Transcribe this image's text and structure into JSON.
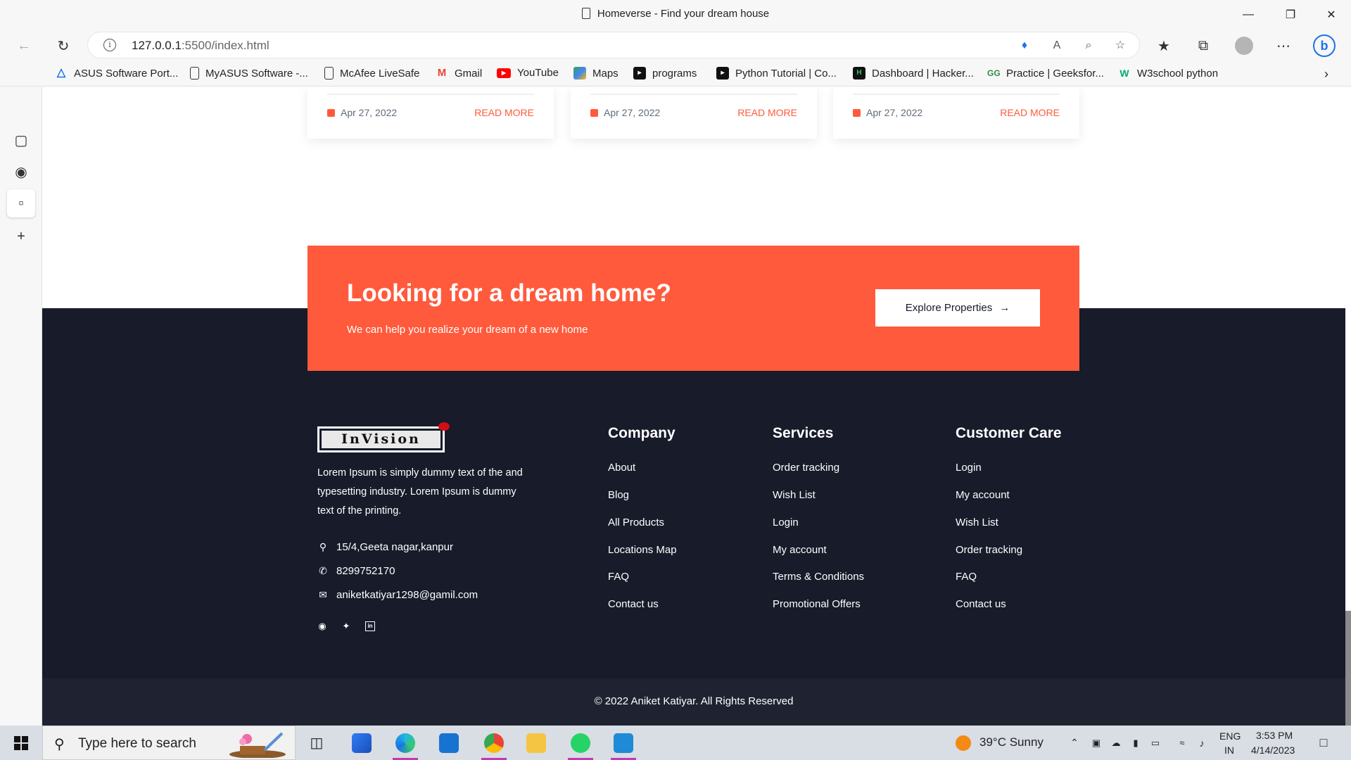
{
  "browser": {
    "window_title": "Homeverse - Find your dream house",
    "url_host": "127.0.0.1",
    "url_rest": ":5500/index.html",
    "bookmarks": [
      {
        "label": "ASUS Software Port...",
        "icon": "asus-icon",
        "color": "#1a73e8"
      },
      {
        "label": "MyASUS Software -...",
        "icon": "page-icon",
        "color": "#ffffff"
      },
      {
        "label": "McAfee LiveSafe",
        "icon": "page-icon",
        "color": "#ffffff"
      },
      {
        "label": "Gmail",
        "icon": "gmail-icon",
        "color": "#ea4335"
      },
      {
        "label": "YouTube",
        "icon": "youtube-icon",
        "color": "#ff0000"
      },
      {
        "label": "Maps",
        "icon": "maps-icon",
        "color": "#34a853"
      },
      {
        "label": "programs",
        "icon": "programs-icon",
        "color": "#111111"
      },
      {
        "label": "Python Tutorial | Co...",
        "icon": "python-icon",
        "color": "#111111"
      },
      {
        "label": "Dashboard | Hacker...",
        "icon": "hackerrank-icon",
        "color": "#111111"
      },
      {
        "label": "Practice | Geeksfor...",
        "icon": "gfg-icon",
        "color": "#2f8d46"
      },
      {
        "label": "W3school python",
        "icon": "w3-icon",
        "color": "#04aa6d"
      }
    ]
  },
  "page": {
    "cards": [
      {
        "date": "Apr 27, 2022",
        "more": "READ MORE"
      },
      {
        "date": "Apr 27, 2022",
        "more": "READ MORE"
      },
      {
        "date": "Apr 27, 2022",
        "more": "READ MORE"
      }
    ],
    "cta": {
      "heading": "Looking for a dream home?",
      "subtext": "We can help you realize your dream of a new home",
      "button": "Explore Properties"
    },
    "footer": {
      "logo_text": "InVision",
      "about": "Lorem Ipsum is simply dummy text of the and typesetting industry. Lorem Ipsum is dummy text of the printing.",
      "address": "15/4,Geeta nagar,kanpur",
      "phone": "8299752170",
      "email": "aniketkatiyar1298@gamil.com",
      "columns": [
        {
          "title": "Company",
          "links": [
            "About",
            "Blog",
            "All Products",
            "Locations Map",
            "FAQ",
            "Contact us"
          ]
        },
        {
          "title": "Services",
          "links": [
            "Order tracking",
            "Wish List",
            "Login",
            "My account",
            "Terms & Conditions",
            "Promotional Offers"
          ]
        },
        {
          "title": "Customer Care",
          "links": [
            "Login",
            "My account",
            "Wish List",
            "Order tracking",
            "FAQ",
            "Contact us"
          ]
        }
      ],
      "copyright": "© 2022 Aniket Katiyar. All Rights Reserved"
    },
    "accent_color": "#ff5a3c",
    "footer_color": "#171b2a"
  },
  "taskbar": {
    "search_placeholder": "Type here to search",
    "weather": "39°C  Sunny",
    "lang_top": "ENG",
    "lang_bottom": "IN",
    "time": "3:53 PM",
    "date": "4/14/2023"
  }
}
